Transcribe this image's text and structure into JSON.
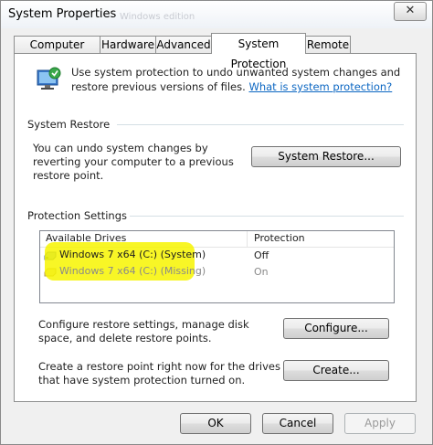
{
  "window": {
    "title": "System Properties",
    "ghost_title": "Windows edition",
    "close_symbol": "✕"
  },
  "tabs": [
    {
      "label": "Computer Name",
      "active": false
    },
    {
      "label": "Hardware",
      "active": false
    },
    {
      "label": "Advanced",
      "active": false
    },
    {
      "label": "System Protection",
      "active": true
    },
    {
      "label": "Remote",
      "active": false
    }
  ],
  "intro": {
    "icon": "system-protection-icon",
    "text": "Use system protection to undo unwanted system changes and restore previous versions of files.",
    "link": "What is system protection?"
  },
  "system_restore": {
    "title": "System Restore",
    "text": "You can undo system changes by reverting your computer to a previous restore point.",
    "button": "System Restore..."
  },
  "protection_settings": {
    "title": "Protection Settings",
    "columns": [
      "Available Drives",
      "Protection"
    ],
    "drives": [
      {
        "name": "Windows 7 x64 (C:) (System)",
        "protection": "Off",
        "icon": "system-drive-icon"
      },
      {
        "name": "Windows 7 x64 (C:) (Missing)",
        "protection": "On",
        "icon": "missing-drive-icon"
      }
    ],
    "configure_text": "Configure restore settings, manage disk space, and delete restore points.",
    "configure_button": "Configure...",
    "create_text": "Create a restore point right now for the drives that have system protection turned on.",
    "create_button": "Create..."
  },
  "footer": {
    "ok": "OK",
    "cancel": "Cancel",
    "apply": "Apply"
  },
  "colors": {
    "link": "#0b66c2",
    "highlight": "#f7f500"
  }
}
